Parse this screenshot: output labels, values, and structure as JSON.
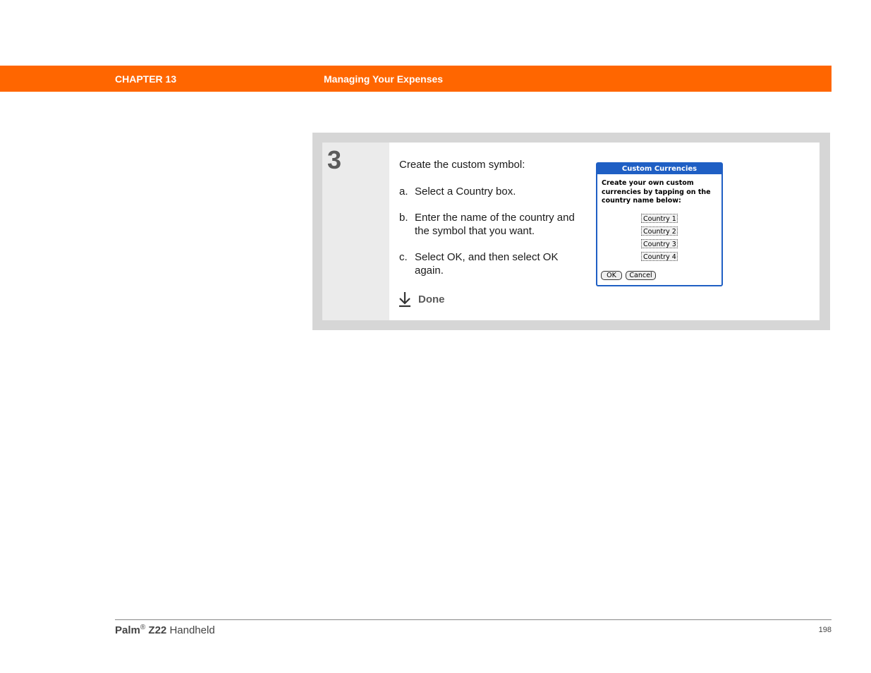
{
  "header": {
    "chapter": "CHAPTER 13",
    "title": "Managing Your Expenses",
    "bar_color": "#ff6600"
  },
  "step": {
    "number": "3",
    "intro": "Create the custom symbol:",
    "items": [
      {
        "marker": "a.",
        "text": "Select a Country box."
      },
      {
        "marker": "b.",
        "text": "Enter the name of the country and the symbol that you want."
      },
      {
        "marker": "c.",
        "text": "Select OK, and then select OK again."
      }
    ],
    "done_label": "Done",
    "done_icon": "down-arrow-icon"
  },
  "dialog": {
    "title": "Custom Currencies",
    "message": "Create your own custom currencies by tapping on the country name below:",
    "countries": [
      "Country 1",
      "Country 2",
      "Country 3",
      "Country 4"
    ],
    "ok_label": "OK",
    "cancel_label": "Cancel",
    "title_color": "#1f5fc4"
  },
  "footer": {
    "brand": "Palm",
    "registered": "®",
    "model": "Z22",
    "product": "Handheld",
    "page": "198"
  }
}
